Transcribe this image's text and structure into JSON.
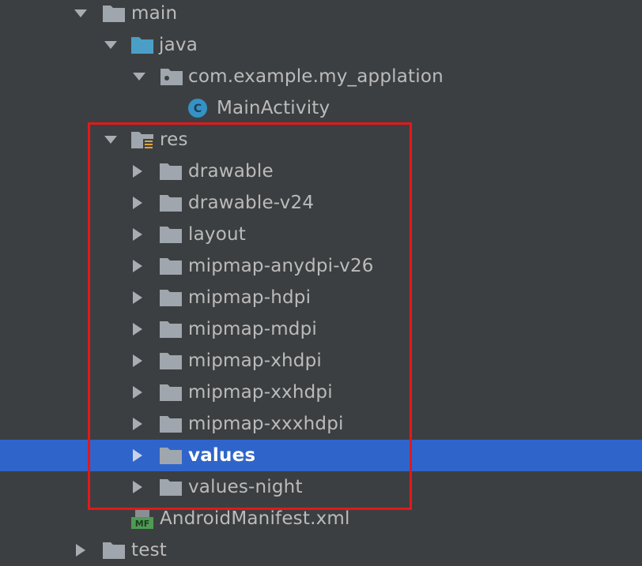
{
  "colors": {
    "background": "#3c3f41",
    "text": "#bbbbbb",
    "selection": "#2f65ca",
    "highlight_border": "#e3181b",
    "folder_gray": "#a0a6ad",
    "folder_blue": "#4b9fc7",
    "class_badge": "#3592c4",
    "manifest_badge": "#4f9b55"
  },
  "tree": {
    "main": {
      "label": "main",
      "state": "expanded",
      "icon": "folder-icon"
    },
    "java": {
      "label": "java",
      "state": "expanded",
      "icon": "source-folder-icon"
    },
    "package": {
      "label": "com.example.my_applation",
      "state": "expanded",
      "icon": "package-icon"
    },
    "main_activity": {
      "label": "MainActivity",
      "icon": "class-icon",
      "badge": "C"
    },
    "res": {
      "label": "res",
      "state": "expanded",
      "icon": "resource-folder-icon"
    },
    "res_children": [
      {
        "label": "drawable",
        "state": "collapsed",
        "selected": false
      },
      {
        "label": "drawable-v24",
        "state": "collapsed",
        "selected": false
      },
      {
        "label": "layout",
        "state": "collapsed",
        "selected": false
      },
      {
        "label": "mipmap-anydpi-v26",
        "state": "collapsed",
        "selected": false
      },
      {
        "label": "mipmap-hdpi",
        "state": "collapsed",
        "selected": false
      },
      {
        "label": "mipmap-mdpi",
        "state": "collapsed",
        "selected": false
      },
      {
        "label": "mipmap-xhdpi",
        "state": "collapsed",
        "selected": false
      },
      {
        "label": "mipmap-xxhdpi",
        "state": "collapsed",
        "selected": false
      },
      {
        "label": "mipmap-xxxhdpi",
        "state": "collapsed",
        "selected": false
      },
      {
        "label": "values",
        "state": "collapsed",
        "selected": true
      },
      {
        "label": "values-night",
        "state": "collapsed",
        "selected": false
      }
    ],
    "manifest": {
      "label": "AndroidManifest.xml",
      "icon": "manifest-icon",
      "badge": "MF"
    },
    "test": {
      "label": "test",
      "state": "collapsed",
      "icon": "folder-icon"
    }
  }
}
